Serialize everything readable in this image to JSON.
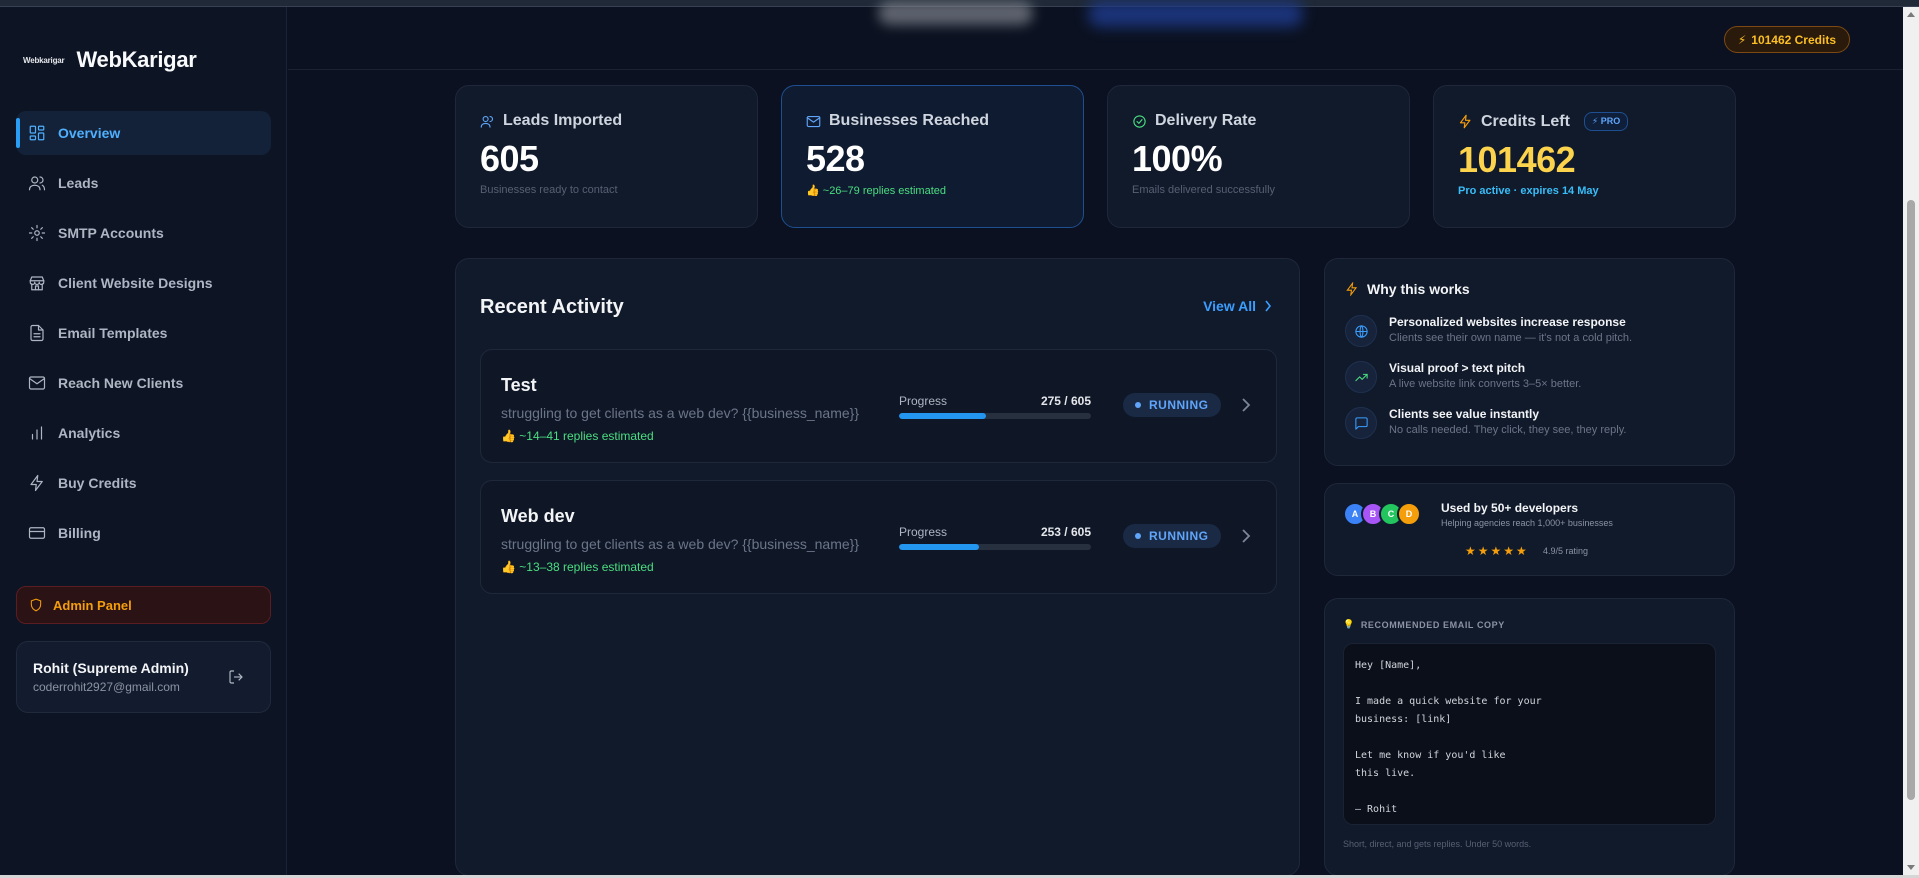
{
  "brand": {
    "logo_text": "Webkarigar",
    "name": "WebKarigar"
  },
  "sidebar": {
    "items": [
      {
        "label": "Overview",
        "icon": "grid-icon",
        "active": true
      },
      {
        "label": "Leads",
        "icon": "users-icon"
      },
      {
        "label": "SMTP Accounts",
        "icon": "gear-icon"
      },
      {
        "label": "Client Website Designs",
        "icon": "store-icon"
      },
      {
        "label": "Email Templates",
        "icon": "document-icon"
      },
      {
        "label": "Reach New Clients",
        "icon": "mail-icon"
      },
      {
        "label": "Analytics",
        "icon": "bar-chart-icon"
      },
      {
        "label": "Buy Credits",
        "icon": "bolt-icon"
      },
      {
        "label": "Billing",
        "icon": "card-icon"
      }
    ],
    "admin_label": "Admin Panel",
    "user": {
      "name": "Rohit (Supreme Admin)",
      "email": "coderrohit2927@gmail.com"
    }
  },
  "header": {
    "credits": "101462 Credits"
  },
  "stats": [
    {
      "title": "Leads Imported",
      "value": "605",
      "sub": "Businesses ready to contact"
    },
    {
      "title": "Businesses Reached",
      "value": "528",
      "sub": "~26–79 replies estimated"
    },
    {
      "title": "Delivery Rate",
      "value": "100%",
      "sub": "Emails delivered successfully"
    },
    {
      "title": "Credits Left",
      "badge": "PRO",
      "value": "101462",
      "sub": "Pro active · expires 14 May"
    }
  ],
  "activity": {
    "title": "Recent Activity",
    "view_all": "View All",
    "campaigns": [
      {
        "name": "Test",
        "message": "struggling to get clients as a web dev? {{business_name}}",
        "estimate": "~14–41 replies estimated",
        "progress_label": "Progress",
        "progress_text": "275 / 605",
        "progress": 0.4545,
        "status": "RUNNING"
      },
      {
        "name": "Web dev",
        "message": "struggling to get clients as a web dev? {{business_name}}",
        "estimate": "~13–38 replies estimated",
        "progress_label": "Progress",
        "progress_text": "253 / 605",
        "progress": 0.4182,
        "status": "RUNNING"
      }
    ]
  },
  "why": {
    "title": "Why this works",
    "items": [
      {
        "title": "Personalized websites increase response",
        "desc": "Clients see their own name — it's not a cold pitch.",
        "icon": "globe-icon"
      },
      {
        "title": "Visual proof > text pitch",
        "desc": "A live website link converts 3–5× better.",
        "icon": "trend-up-icon"
      },
      {
        "title": "Clients see value instantly",
        "desc": "No calls needed. They click, they see, they reply.",
        "icon": "chat-icon"
      }
    ]
  },
  "social": {
    "avatars": [
      {
        "letter": "A",
        "color": "#3b82f6"
      },
      {
        "letter": "B",
        "color": "#a855f7"
      },
      {
        "letter": "C",
        "color": "#22c55e"
      },
      {
        "letter": "D",
        "color": "#f59e0b"
      }
    ],
    "title": "Used by 50+ developers",
    "desc": "Helping agencies reach 1,000+ businesses",
    "stars": "★★★★★",
    "rating": "4.9/5 rating"
  },
  "recommended": {
    "title": "RECOMMENDED EMAIL COPY",
    "lines": [
      "Hey [Name],",
      "",
      "I made a quick website for your",
      "business: [link]",
      "",
      "Let me know if you'd like",
      "this live.",
      "",
      "— Rohit"
    ],
    "footer": "Short, direct, and gets replies. Under 50 words."
  },
  "colors": {
    "accent": "#3b9eff",
    "gold": "#fcd34d",
    "success": "#4ade80",
    "warning": "#f59e0b"
  }
}
